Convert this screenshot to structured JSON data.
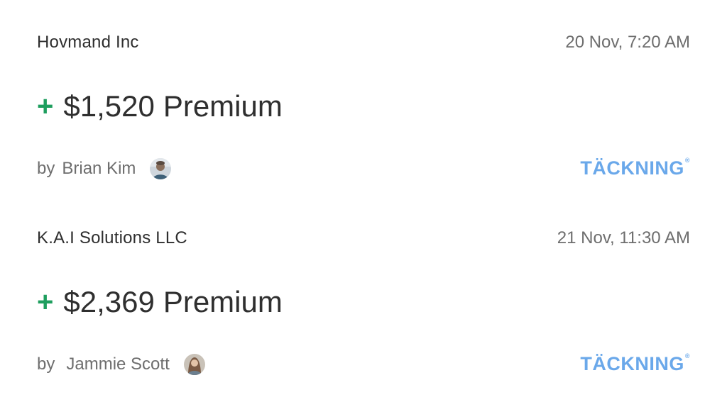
{
  "colors": {
    "accent_plus": "#1e9e5e",
    "brand": "#6aa8ea",
    "primary_text": "#2e2e2e",
    "secondary_text": "#6e6e6e"
  },
  "entries": [
    {
      "company": "Hovmand Inc",
      "time": "20 Nov, 7:20 AM",
      "plus": "+",
      "amount": "$1,520",
      "premium_label": "Premium",
      "by_label": "by",
      "agent_name": "Brian Kim",
      "avatar_icon": "avatar-photo",
      "brand_name": "TÄCKNING",
      "brand_mark": "®"
    },
    {
      "company": "K.A.I Solutions LLC",
      "time": "21 Nov, 11:30 AM",
      "plus": "+",
      "amount": "$2,369",
      "premium_label": "Premium",
      "by_label": "by",
      "agent_name": "Jammie Scott",
      "avatar_icon": "avatar-photo",
      "brand_name": "TÄCKNING",
      "brand_mark": "®"
    }
  ]
}
